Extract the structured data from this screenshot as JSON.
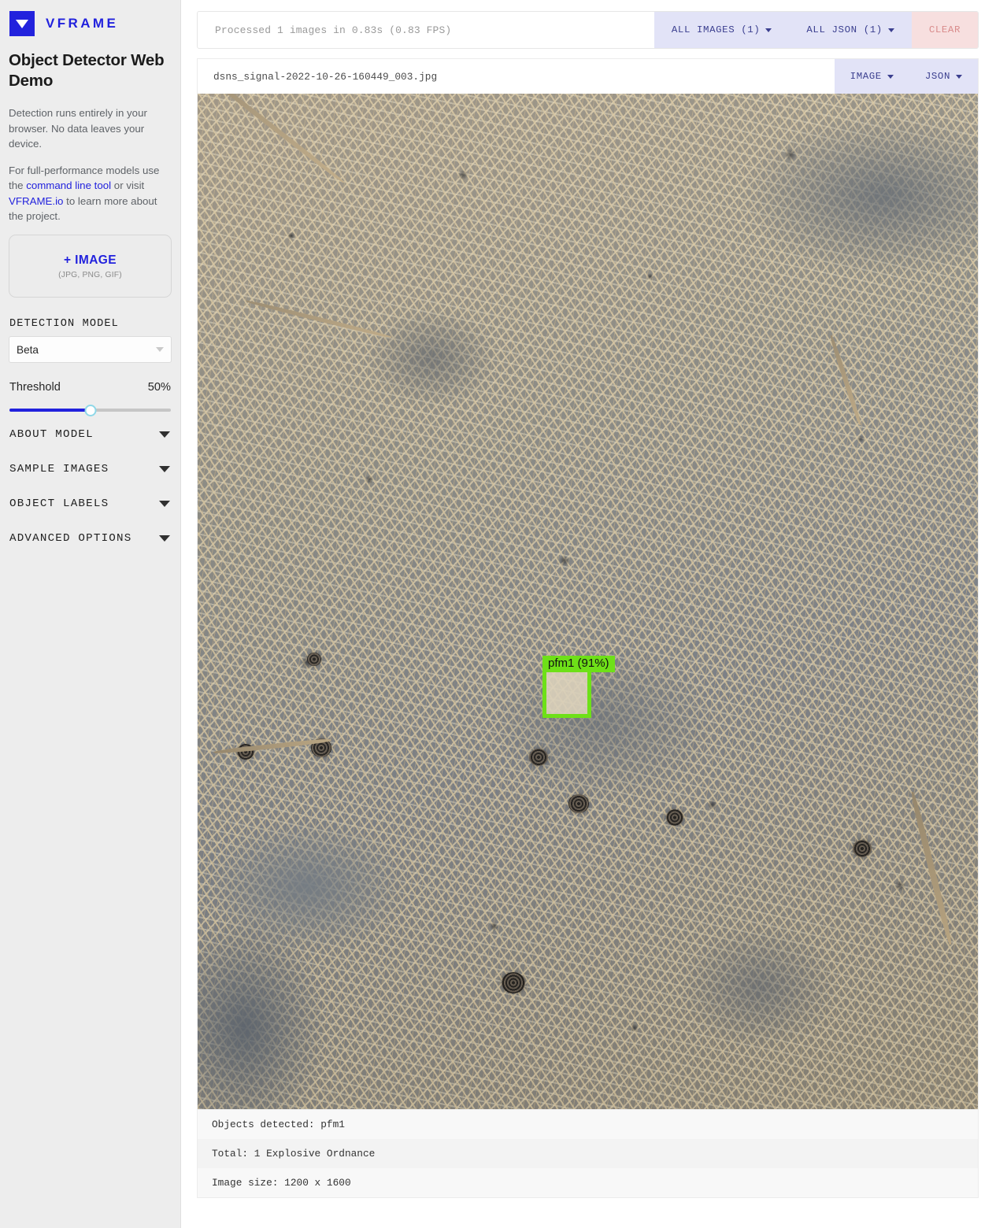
{
  "sidebar": {
    "brand": "VFRAME",
    "logo_icon": "triangle-down-icon",
    "title": "Object Detector Web Demo",
    "privacy_text": "Detection runs entirely in your browser. No data leaves your device.",
    "info_prefix": "For full-performance models use the ",
    "info_link1": "command line tool",
    "info_mid": " or visit ",
    "info_link2": "VFRAME.io",
    "info_suffix": " to learn more about the project.",
    "upload": {
      "label": "+ IMAGE",
      "hint": "(JPG, PNG, GIF)"
    },
    "model_section_label": "DETECTION MODEL",
    "model_selected": "Beta",
    "threshold": {
      "label": "Threshold",
      "value_label": "50%",
      "value": 50
    },
    "accordions": [
      {
        "label": "ABOUT MODEL"
      },
      {
        "label": "SAMPLE IMAGES"
      },
      {
        "label": "OBJECT LABELS"
      },
      {
        "label": "ADVANCED OPTIONS"
      }
    ]
  },
  "toolbar": {
    "status": "Processed 1 images in 0.83s (0.83 FPS)",
    "all_images": "ALL IMAGES (1)",
    "all_json": "ALL JSON (1)",
    "clear": "CLEAR"
  },
  "result": {
    "filename": "dsns_signal-2022-10-26-160449_003.jpg",
    "image_button": "IMAGE",
    "json_button": "JSON",
    "detection": {
      "label": "pfm1 (91%)",
      "class": "pfm1",
      "confidence": "91%",
      "box_color": "#6ee018"
    },
    "status_rows": [
      "Objects detected: pfm1",
      "Total: 1 Explosive Ordnance",
      "Image size: 1200 x 1600"
    ]
  }
}
